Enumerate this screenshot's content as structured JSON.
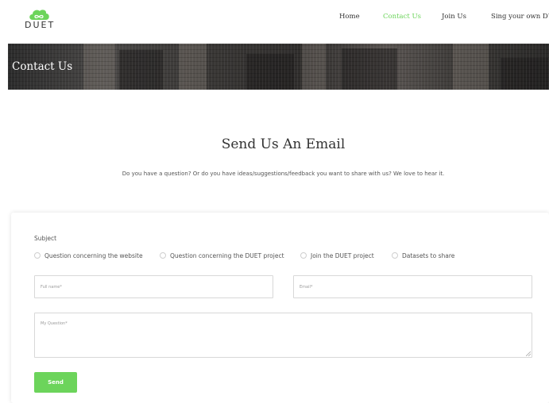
{
  "header": {
    "logo_text": "DUET",
    "nav": [
      {
        "label": "Home",
        "active": false
      },
      {
        "label": "Contact Us",
        "active": true
      },
      {
        "label": "Join Us",
        "active": false
      },
      {
        "label": "Sing your own DUET",
        "active": false
      }
    ],
    "accent_color": "#6cd45b"
  },
  "hero": {
    "title": "Contact Us"
  },
  "section": {
    "title": "Send Us An Email",
    "subtitle": "Do you have a question? Or do you have ideas/suggestions/feedback you want to share with us? We love to hear it."
  },
  "form": {
    "subject_label": "Subject",
    "subject_options": [
      "Question concerning the website",
      "Question concerning the DUET project",
      "Join the DUET project",
      "Datasets to share"
    ],
    "full_name_placeholder": "Full name*",
    "email_placeholder": "Email*",
    "question_placeholder": "My Question*",
    "send_label": "Send"
  }
}
